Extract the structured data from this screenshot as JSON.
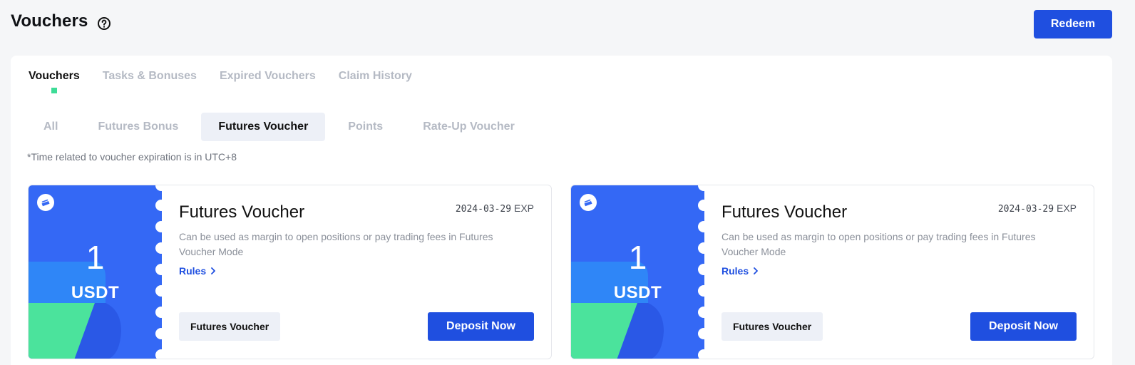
{
  "header": {
    "title": "Vouchers",
    "help_icon": "question-circle-icon",
    "redeem_label": "Redeem"
  },
  "main_tabs": [
    {
      "label": "Vouchers",
      "active": true
    },
    {
      "label": "Tasks & Bonuses",
      "active": false
    },
    {
      "label": "Expired Vouchers",
      "active": false
    },
    {
      "label": "Claim History",
      "active": false
    }
  ],
  "sub_tabs": [
    {
      "label": "All",
      "active": false
    },
    {
      "label": "Futures Bonus",
      "active": false
    },
    {
      "label": "Futures Voucher",
      "active": true
    },
    {
      "label": "Points",
      "active": false
    },
    {
      "label": "Rate-Up Voucher",
      "active": false
    }
  ],
  "note": "*Time related to voucher expiration is in UTC+8",
  "colors": {
    "accent": "#1f4fe0",
    "stub_blue": "#3468f5",
    "stub_green": "#4be39c",
    "indicator": "#3ddc97"
  },
  "vouchers": [
    {
      "amount": "1",
      "unit": "USDT",
      "title": "Futures Voucher",
      "exp_date": "2024-03-29",
      "exp_label": "EXP",
      "description": "Can be used as margin to open positions or pay trading fees in Futures Voucher Mode",
      "rules_label": "Rules",
      "tag": "Futures Voucher",
      "action_label": "Deposit Now",
      "icon": "ticket-icon"
    },
    {
      "amount": "1",
      "unit": "USDT",
      "title": "Futures Voucher",
      "exp_date": "2024-03-29",
      "exp_label": "EXP",
      "description": "Can be used as margin to open positions or pay trading fees in Futures Voucher Mode",
      "rules_label": "Rules",
      "tag": "Futures Voucher",
      "action_label": "Deposit Now",
      "icon": "ticket-icon"
    }
  ]
}
